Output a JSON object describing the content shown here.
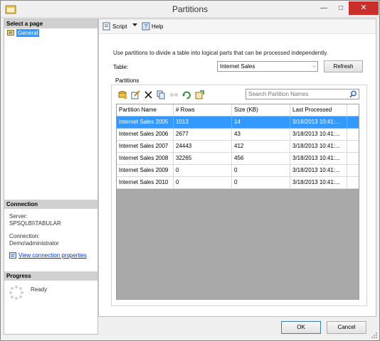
{
  "window": {
    "title": "Partitions"
  },
  "left_pane": {
    "select_page_header": "Select a page",
    "pages": [
      {
        "label": "General"
      }
    ],
    "connection_header": "Connection",
    "server_label": "Server:",
    "server_value": "SPSQLBI\\TABULAR",
    "connection_label": "Connection:",
    "connection_value": "Demo\\administrator",
    "view_link": "View connection properties",
    "progress_header": "Progress",
    "progress_status": "Ready"
  },
  "toolbar": {
    "script_label": "Script",
    "help_label": "Help"
  },
  "main": {
    "description": "Use partitions to divide a table into logical parts that can be processed independently.",
    "table_label": "Table:",
    "table_value": "Internet Sales",
    "refresh_label": "Refresh",
    "partitions_label": "Partitions",
    "search_placeholder": "Search Partition Names"
  },
  "grid": {
    "columns": [
      "Partition Name",
      "# Rows",
      "Size (KB)",
      "Last Processed"
    ],
    "rows": [
      {
        "name": "Internet Sales 2005",
        "rows": "1013",
        "size": "14",
        "processed": "3/18/2013 10:41:...",
        "selected": true
      },
      {
        "name": "Internet Sales 2006",
        "rows": "2677",
        "size": "43",
        "processed": "3/18/2013 10:41:...",
        "selected": false
      },
      {
        "name": "Internet Sales 2007",
        "rows": "24443",
        "size": "412",
        "processed": "3/18/2013 10:41:...",
        "selected": false
      },
      {
        "name": "Internet Sales 2008",
        "rows": "32265",
        "size": "456",
        "processed": "3/18/2013 10:41:...",
        "selected": false
      },
      {
        "name": "Internet Sales 2009",
        "rows": "0",
        "size": "0",
        "processed": "3/18/2013 10:41:...",
        "selected": false
      },
      {
        "name": "Internet Sales 2010",
        "rows": "0",
        "size": "0",
        "processed": "3/18/2013 10:41:...",
        "selected": false
      }
    ]
  },
  "buttons": {
    "ok": "OK",
    "cancel": "Cancel"
  },
  "colors": {
    "selection": "#3399ff",
    "close_button": "#c9302c",
    "grid_background": "#a9a9a9"
  }
}
